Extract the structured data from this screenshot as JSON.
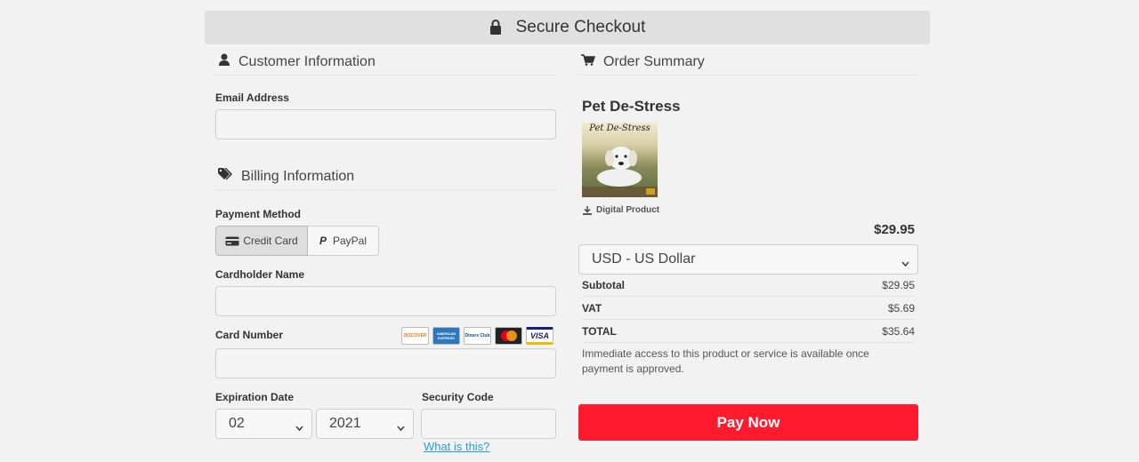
{
  "header": {
    "title": "Secure Checkout"
  },
  "customer": {
    "heading": "Customer Information",
    "email_label": "Email Address",
    "email_value": ""
  },
  "billing": {
    "heading": "Billing Information",
    "payment_method_label": "Payment Method",
    "methods": [
      {
        "label": "Credit Card",
        "selected": true
      },
      {
        "label": "PayPal",
        "selected": false
      }
    ],
    "cardholder_label": "Cardholder Name",
    "cardholder_value": "",
    "card_number_label": "Card Number",
    "card_number_value": "",
    "card_brands": [
      "DISCOVER",
      "AMERICAN EXPRESS",
      "Diners Club",
      "mastercard",
      "VISA"
    ],
    "expiration_label": "Expiration Date",
    "exp_month": "02",
    "exp_year": "2021",
    "security_label": "Security Code",
    "security_value": "",
    "security_help": "What is this?"
  },
  "summary": {
    "heading": "Order Summary",
    "product_title": "Pet De-Stress",
    "product_image_text": "Pet De-Stress",
    "product_type": "Digital Product",
    "price": "$29.95",
    "currency": "USD - US Dollar",
    "rows": [
      {
        "label": "Subtotal",
        "value": "$29.95"
      },
      {
        "label": "VAT",
        "value": "$5.69"
      },
      {
        "label": "TOTAL",
        "value": "$35.64"
      }
    ],
    "note": "Immediate access to this product or service is available once payment is approved.",
    "pay_label": "Pay Now"
  },
  "colors": {
    "pay_button": "#ff1a2e",
    "link": "#2a9fd6",
    "header_bg": "#e0e0e0"
  }
}
